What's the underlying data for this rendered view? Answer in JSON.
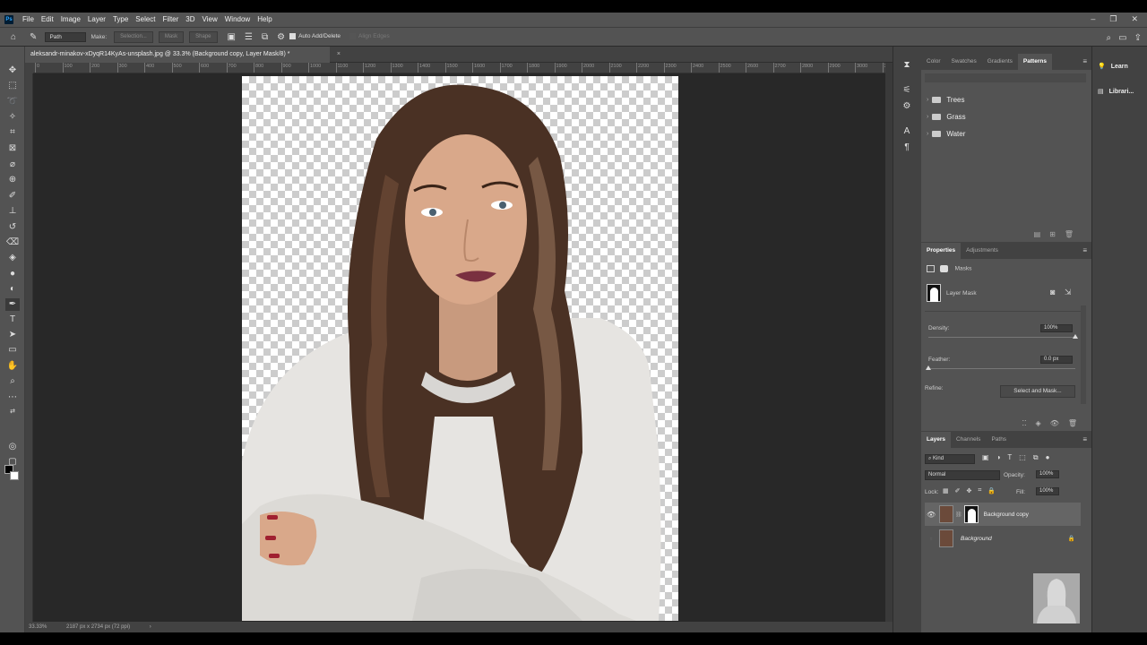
{
  "app": {
    "logo": "Ps"
  },
  "menu": [
    "File",
    "Edit",
    "Image",
    "Layer",
    "Type",
    "Select",
    "Filter",
    "3D",
    "View",
    "Window",
    "Help"
  ],
  "window_controls": [
    "–",
    "❐",
    "✕"
  ],
  "options": {
    "mode": "Path",
    "make_label": "Make:",
    "selection": "Selection...",
    "mask": "Mask",
    "shape": "Shape",
    "auto_add": "Auto Add/Delete",
    "align_edges": "Align Edges"
  },
  "document_tab": {
    "title": "aleksandr-minakov-xDyqR14KyAs-unsplash.jpg @ 33.3% (Background copy, Layer Mask/8) *",
    "close": "×"
  },
  "ruler_ticks": [
    "0",
    "100",
    "200",
    "300",
    "400",
    "500",
    "600",
    "700",
    "800",
    "900",
    "1000",
    "1100",
    "1200",
    "1300",
    "1400",
    "1500",
    "1600",
    "1700",
    "1800",
    "1900",
    "2000",
    "2100",
    "2200",
    "2300",
    "2400",
    "2500",
    "2600",
    "2700",
    "2800",
    "2900",
    "3000",
    "3100"
  ],
  "status": {
    "zoom": "33.33%",
    "size": "2187 px x 2734 px (72 ppi)",
    "arrow": "›"
  },
  "patterns_panel": {
    "tabs": [
      "Color",
      "Swatches",
      "Gradients",
      "Patterns"
    ],
    "active_tab": "Patterns",
    "folders": [
      "Trees",
      "Grass",
      "Water"
    ]
  },
  "properties_panel": {
    "tabs": [
      "Properties",
      "Adjustments"
    ],
    "section": "Masks",
    "layer_mask": "Layer Mask",
    "density_label": "Density:",
    "density_value": "100%",
    "density": 1.0,
    "feather_label": "Feather:",
    "feather_value": "0.0 px",
    "feather": 0.0,
    "refine_label": "Refine:",
    "select_and_mask": "Select and Mask..."
  },
  "layers_panel": {
    "tabs": [
      "Layers",
      "Channels",
      "Paths"
    ],
    "filter_kind": "Kind",
    "blend_mode": "Normal",
    "opacity_label": "Opacity:",
    "opacity": "100%",
    "lock_label": "Lock:",
    "fill_label": "Fill:",
    "fill": "100%",
    "layers": [
      {
        "name": "Background copy",
        "visible": true,
        "selected": true
      },
      {
        "name": "Background",
        "visible": false,
        "locked": true
      }
    ]
  },
  "right_strip": {
    "learn": "Learn",
    "libraries": "Librari..."
  },
  "colors": {
    "ui_bg": "#535353",
    "dark_bg": "#424242",
    "canvas_bg": "#282828",
    "accent": "#31a8ff"
  }
}
